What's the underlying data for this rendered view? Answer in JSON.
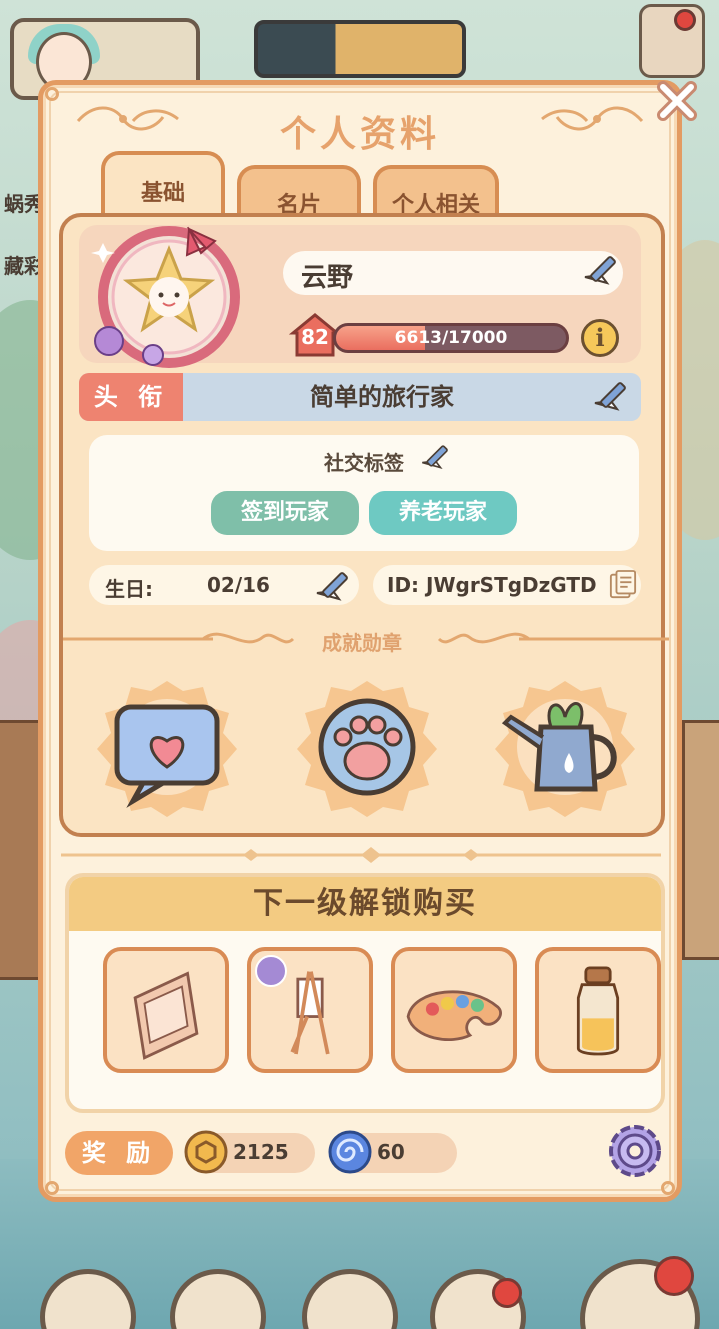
{
  "modal": {
    "title": "个人资料",
    "tabs": [
      {
        "label": "基础",
        "active": true
      },
      {
        "label": "名片",
        "active": false
      },
      {
        "label": "个人相关",
        "active": false
      }
    ]
  },
  "profile": {
    "name": "云野",
    "level": "82",
    "exp_text": "6613/17000",
    "exp_progress": 0.389,
    "info_symbol": "i",
    "title_tag": "头 衔",
    "title_value": "简单的旅行家",
    "social_label": "社交标签",
    "social_tags": [
      {
        "label": "签到玩家",
        "color": "#7fbfa9"
      },
      {
        "label": "养老玩家",
        "color": "#6ec9c2"
      }
    ],
    "birthday_label": "生日:",
    "birthday_value": "02/16",
    "id_text": "ID: JWgrSTgDzGTD"
  },
  "achievements": {
    "title": "成就勋章",
    "badges": [
      "chat-heart-badge",
      "paw-badge",
      "watering-can-badge"
    ]
  },
  "unlock": {
    "title": "下一级解锁购买",
    "items": [
      "folding-screen-item",
      "easel-item",
      "paint-palette-item",
      "bottle-item"
    ]
  },
  "footer": {
    "reward_label": "奖 励",
    "coins": "2125",
    "swirls": "60"
  },
  "background": {
    "side_labels": [
      "蜗秀",
      "藏彩"
    ]
  },
  "colors": {
    "modal_border": "#e39b62",
    "title": "#e6a26c",
    "title_tag": "#ee8370",
    "exp_fill": "#ea6e5f"
  }
}
